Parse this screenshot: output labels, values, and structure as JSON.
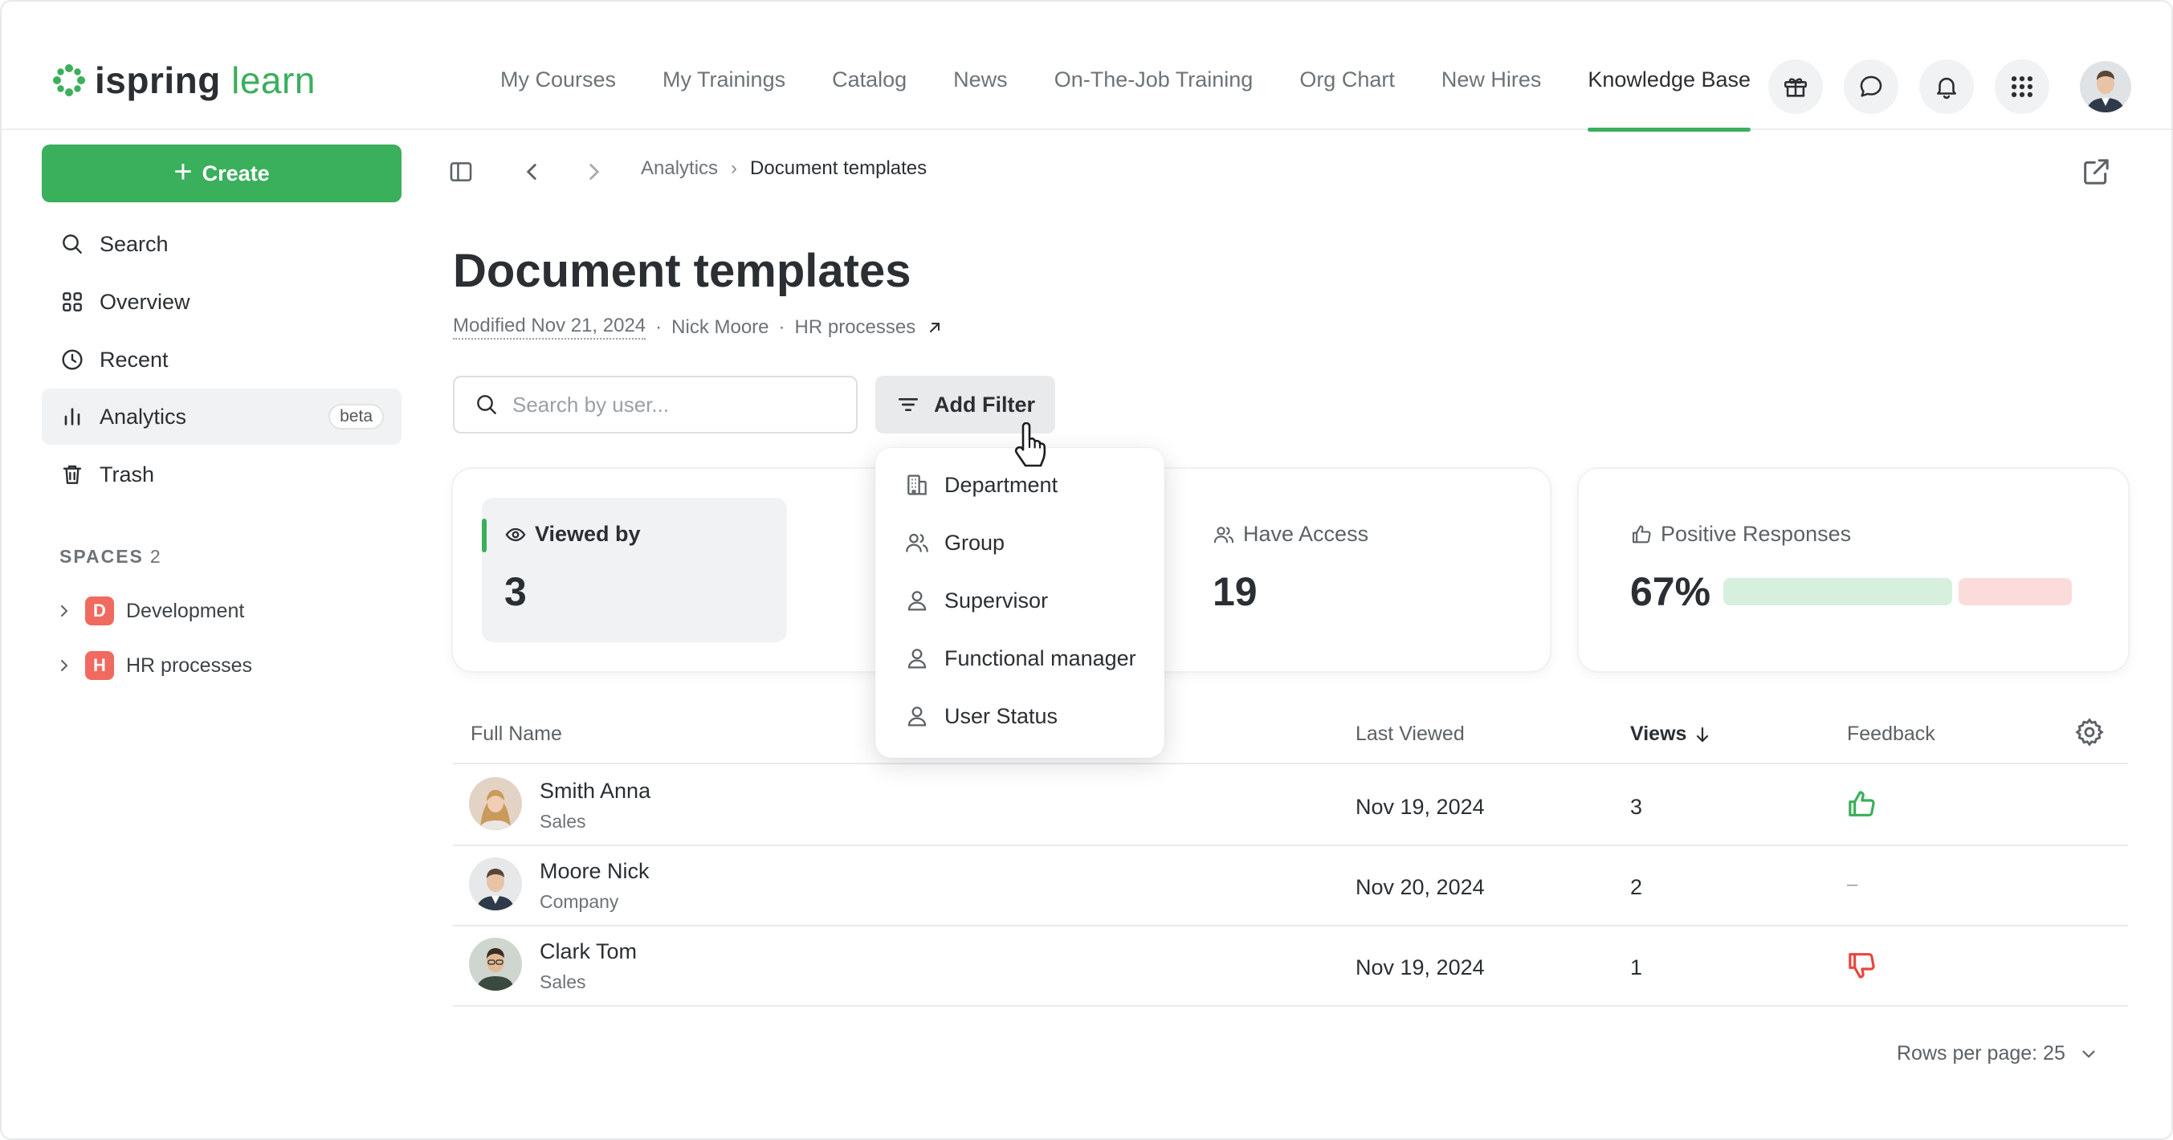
{
  "logo": {
    "part1": "ispring",
    "part2": "learn"
  },
  "nav": {
    "items": [
      {
        "label": "My Courses"
      },
      {
        "label": "My Trainings"
      },
      {
        "label": "Catalog"
      },
      {
        "label": "News"
      },
      {
        "label": "On-The-Job Training"
      },
      {
        "label": "Org Chart"
      },
      {
        "label": "New Hires"
      },
      {
        "label": "Knowledge Base",
        "active": true
      }
    ]
  },
  "top_icons": [
    "gift-icon",
    "chat-icon",
    "bell-icon",
    "apps-grid-icon"
  ],
  "sidebar": {
    "create_label": "Create",
    "items": [
      {
        "label": "Search",
        "icon": "search-icon"
      },
      {
        "label": "Overview",
        "icon": "grid-icon"
      },
      {
        "label": "Recent",
        "icon": "clock-icon"
      },
      {
        "label": "Analytics",
        "icon": "bar-chart-icon",
        "badge": "beta",
        "active": true
      },
      {
        "label": "Trash",
        "icon": "trash-icon"
      }
    ],
    "spaces_label": "SPACES",
    "spaces_count": "2",
    "spaces": [
      {
        "letter": "D",
        "label": "Development"
      },
      {
        "letter": "H",
        "label": "HR processes"
      }
    ]
  },
  "breadcrumb": {
    "parent": "Analytics",
    "current": "Document templates"
  },
  "page": {
    "title": "Document templates",
    "modified": "Modified Nov 21, 2024",
    "author": "Nick Moore",
    "space": "HR processes"
  },
  "search": {
    "placeholder": "Search by user..."
  },
  "filter_button": {
    "label": "Add Filter"
  },
  "filter_menu": {
    "items": [
      {
        "label": "Department",
        "icon": "building-icon"
      },
      {
        "label": "Group",
        "icon": "group-icon"
      },
      {
        "label": "Supervisor",
        "icon": "person-icon"
      },
      {
        "label": "Functional manager",
        "icon": "person-icon"
      },
      {
        "label": "User Status",
        "icon": "person-icon"
      }
    ]
  },
  "stats": {
    "viewed_by": {
      "label": "Viewed by",
      "value": "3"
    },
    "have_access": {
      "label": "Have Access",
      "value": "19"
    },
    "positive": {
      "label": "Positive Responses",
      "value": "67%",
      "positive_fraction": 0.67
    }
  },
  "colors": {
    "accent": "#3aaf5c",
    "negative": "#e5483c",
    "positive_bar": "#d6f0dd",
    "negative_bar": "#fbdcda"
  },
  "table": {
    "headers": {
      "name": "Full Name",
      "last_viewed": "Last Viewed",
      "views": "Views",
      "feedback": "Feedback"
    },
    "rows": [
      {
        "name": "Smith Anna",
        "dept": "Sales",
        "last_viewed": "Nov 19, 2024",
        "views": "3",
        "feedback": "positive"
      },
      {
        "name": "Moore Nick",
        "dept": "Company",
        "last_viewed": "Nov 20, 2024",
        "views": "2",
        "feedback": "none",
        "feedback_text": "–"
      },
      {
        "name": "Clark Tom",
        "dept": "Sales",
        "last_viewed": "Nov 19, 2024",
        "views": "1",
        "feedback": "negative"
      }
    ]
  },
  "pagination": {
    "rows_per_page": "Rows per page: 25"
  }
}
